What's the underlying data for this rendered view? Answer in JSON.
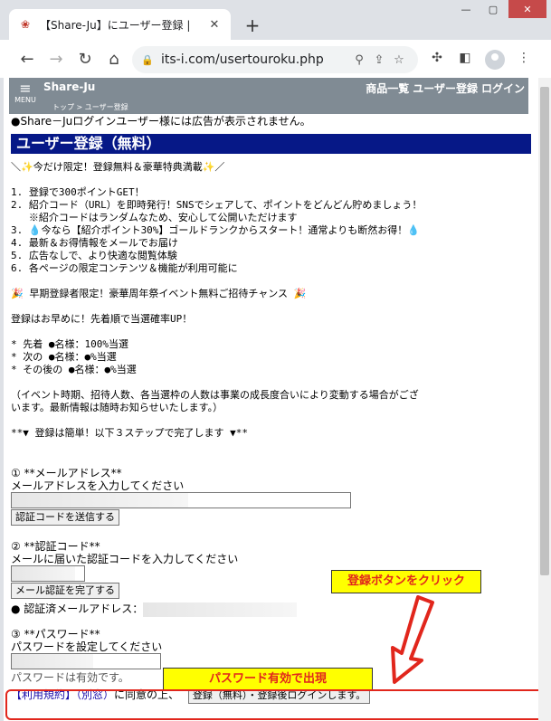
{
  "browser": {
    "tab_title": "【Share-Ju】にユーザー登録 |",
    "url": "its-i.com/usertouroku.php",
    "new_tab": "+",
    "window_controls": {
      "minimize": "—",
      "maximize": "▢",
      "close": "✕"
    }
  },
  "site": {
    "menu_label": "MENU",
    "title": "Share-Ju",
    "breadcrumb": "トップ > ユーザー登録",
    "nav": [
      "商品一覧",
      "ユーザー登録",
      "ログイン"
    ]
  },
  "page": {
    "ad_note": "●Share－Juログインユーザー様には広告が表示されません。",
    "heading": "ユーザー登録（無料）",
    "promo": "＼✨今だけ限定！登録無料＆豪華特典満載✨／",
    "benefits": [
      "1. 登録で300ポイントGET！",
      "2. 紹介コード（URL）を即時発行！SNSでシェアして、ポイントをどんどん貯めましょう！",
      "   ※紹介コードはランダムなため、安心して公開いただけます",
      "3. 💧今なら【紹介ポイント30%】ゴールドランクからスタート！通常よりも断然お得！💧",
      "4. 最新＆お得情報をメールでお届け",
      "5. 広告なしで、より快適な閲覧体験",
      "6. 各ページの限定コンテンツ＆機能が利用可能に"
    ],
    "event": "🎉 早期登録者限定！豪華周年祭イベント無料ご招待チャンス 🎉",
    "early": "登録はお早めに！先着順で当選確率UP！",
    "lottery": [
      "* 先着 ●名様：100%当選",
      "* 次の ●名様：●%当選",
      "* その後の ●名様：●%当選"
    ],
    "note_lines": [
      "（イベント時期、招待人数、各当選枠の人数は事業の成長度合いにより変動する場合がござ",
      "います。最新情報は随時お知らせいたします。）"
    ],
    "steps_intro": "**▼ 登録は簡単！以下３ステップで完了します ▼**",
    "step1": {
      "title": "① **メールアドレス**",
      "desc": "メールアドレスを入力してください",
      "button": "認証コードを送信する"
    },
    "step2": {
      "title": "② **認証コード**",
      "desc": "メールに届いた認証コードを入力してください",
      "button": "メール認証を完了する",
      "verified_label": "● 認証済メールアドレス："
    },
    "step3": {
      "title": "③ **パスワード**",
      "desc": "パスワードを設定してください",
      "status": "パスワードは有効です。"
    },
    "terms_link": "【利用規約】",
    "terms_alt": "（別窓）",
    "agree_text": "に同意の上、",
    "submit_button": "登録（無料）・登録後ログインします。"
  },
  "annotations": {
    "click_register": "登録ボタンをクリック",
    "password_valid": "パスワード有効で出現"
  },
  "colors": {
    "heading_bg": "#061887",
    "site_header_bg": "#808b94",
    "callout_bg": "#ffff00",
    "callout_text": "#e1261c",
    "link": "#1a0dab"
  }
}
